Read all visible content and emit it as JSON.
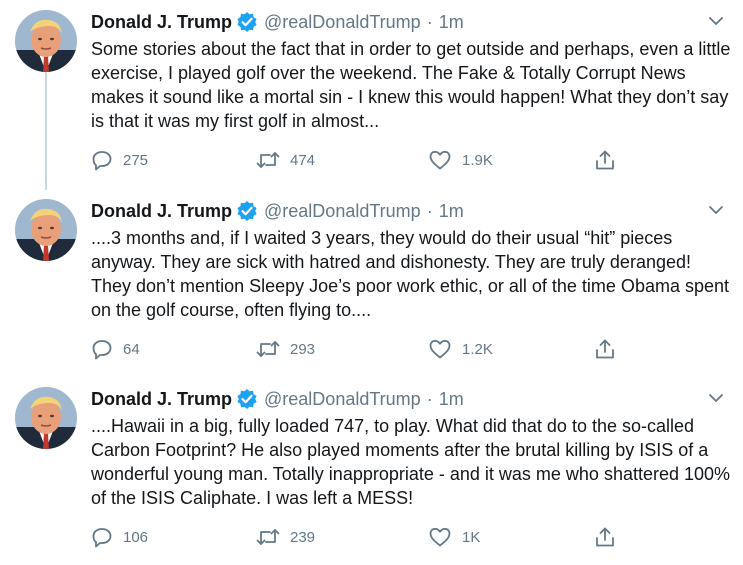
{
  "tweets": [
    {
      "name": "Donald J. Trump",
      "handle": "@realDonaldTrump",
      "separator": "·",
      "time": "1m",
      "text": "Some stories about the fact that in order to get outside and perhaps, even a little exercise, I played golf over the weekend. The Fake & Totally Corrupt News makes it sound like a mortal sin - I knew this would happen! What they don’t say is that it was my first golf in almost...",
      "replies": "275",
      "retweets": "474",
      "likes": "1.9K"
    },
    {
      "name": "Donald J. Trump",
      "handle": "@realDonaldTrump",
      "separator": "·",
      "time": "1m",
      "text": "....3 months and, if I waited 3 years, they would do their usual “hit” pieces anyway. They are sick with hatred and dishonesty. They are truly deranged! They don’t mention Sleepy Joe’s poor work ethic,  or all of the time Obama spent on the golf course, often flying to....",
      "replies": "64",
      "retweets": "293",
      "likes": "1.2K"
    },
    {
      "name": "Donald J. Trump",
      "handle": "@realDonaldTrump",
      "separator": "·",
      "time": "1m",
      "text": "....Hawaii in a big, fully loaded 747, to play. What did that do to the so-called Carbon Footprint? He also played moments after the brutal killing by ISIS of a wonderful young man. Totally inappropriate - and it was me who shattered 100% of the ISIS Caliphate. I was left a MESS!",
      "replies": "106",
      "retweets": "239",
      "likes": "1K"
    }
  ],
  "colors": {
    "text": "#14171a",
    "secondary": "#657786",
    "verified": "#1da1f2",
    "thread_line": "#ccd6dd"
  },
  "icons": {
    "reply": "reply-icon",
    "retweet": "retweet-icon",
    "like": "heart-icon",
    "share": "share-icon",
    "caret": "chevron-down-icon",
    "verified": "verified-badge-icon"
  }
}
